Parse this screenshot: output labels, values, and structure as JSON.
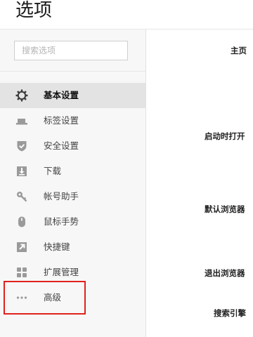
{
  "header": {
    "title": "选项"
  },
  "search": {
    "placeholder": "搜索选项",
    "value": ""
  },
  "sidebar": {
    "items": [
      {
        "label": "基本设置",
        "icon": "gear-icon",
        "active": true
      },
      {
        "label": "标签设置",
        "icon": "tab-icon"
      },
      {
        "label": "安全设置",
        "icon": "shield-icon"
      },
      {
        "label": "下载",
        "icon": "download-icon"
      },
      {
        "label": "帐号助手",
        "icon": "key-icon"
      },
      {
        "label": "鼠标手势",
        "icon": "mouse-icon"
      },
      {
        "label": "快捷键",
        "icon": "shortcut-arrow-icon"
      },
      {
        "label": "扩展管理",
        "icon": "extensions-grid-icon"
      },
      {
        "label": "高级",
        "icon": "more-dots-icon",
        "highlighted": true
      }
    ]
  },
  "main": {
    "sections": [
      {
        "label": "主页"
      },
      {
        "label": "启动时打开"
      },
      {
        "label": "默认浏览器"
      },
      {
        "label": "退出浏览器"
      },
      {
        "label": "搜索引擎"
      }
    ]
  },
  "colors": {
    "active_background": "#e3e3e3",
    "highlight_border": "#e0211d",
    "icon_gray": "#9a9a9a",
    "icon_dark": "#3a3a3a"
  }
}
